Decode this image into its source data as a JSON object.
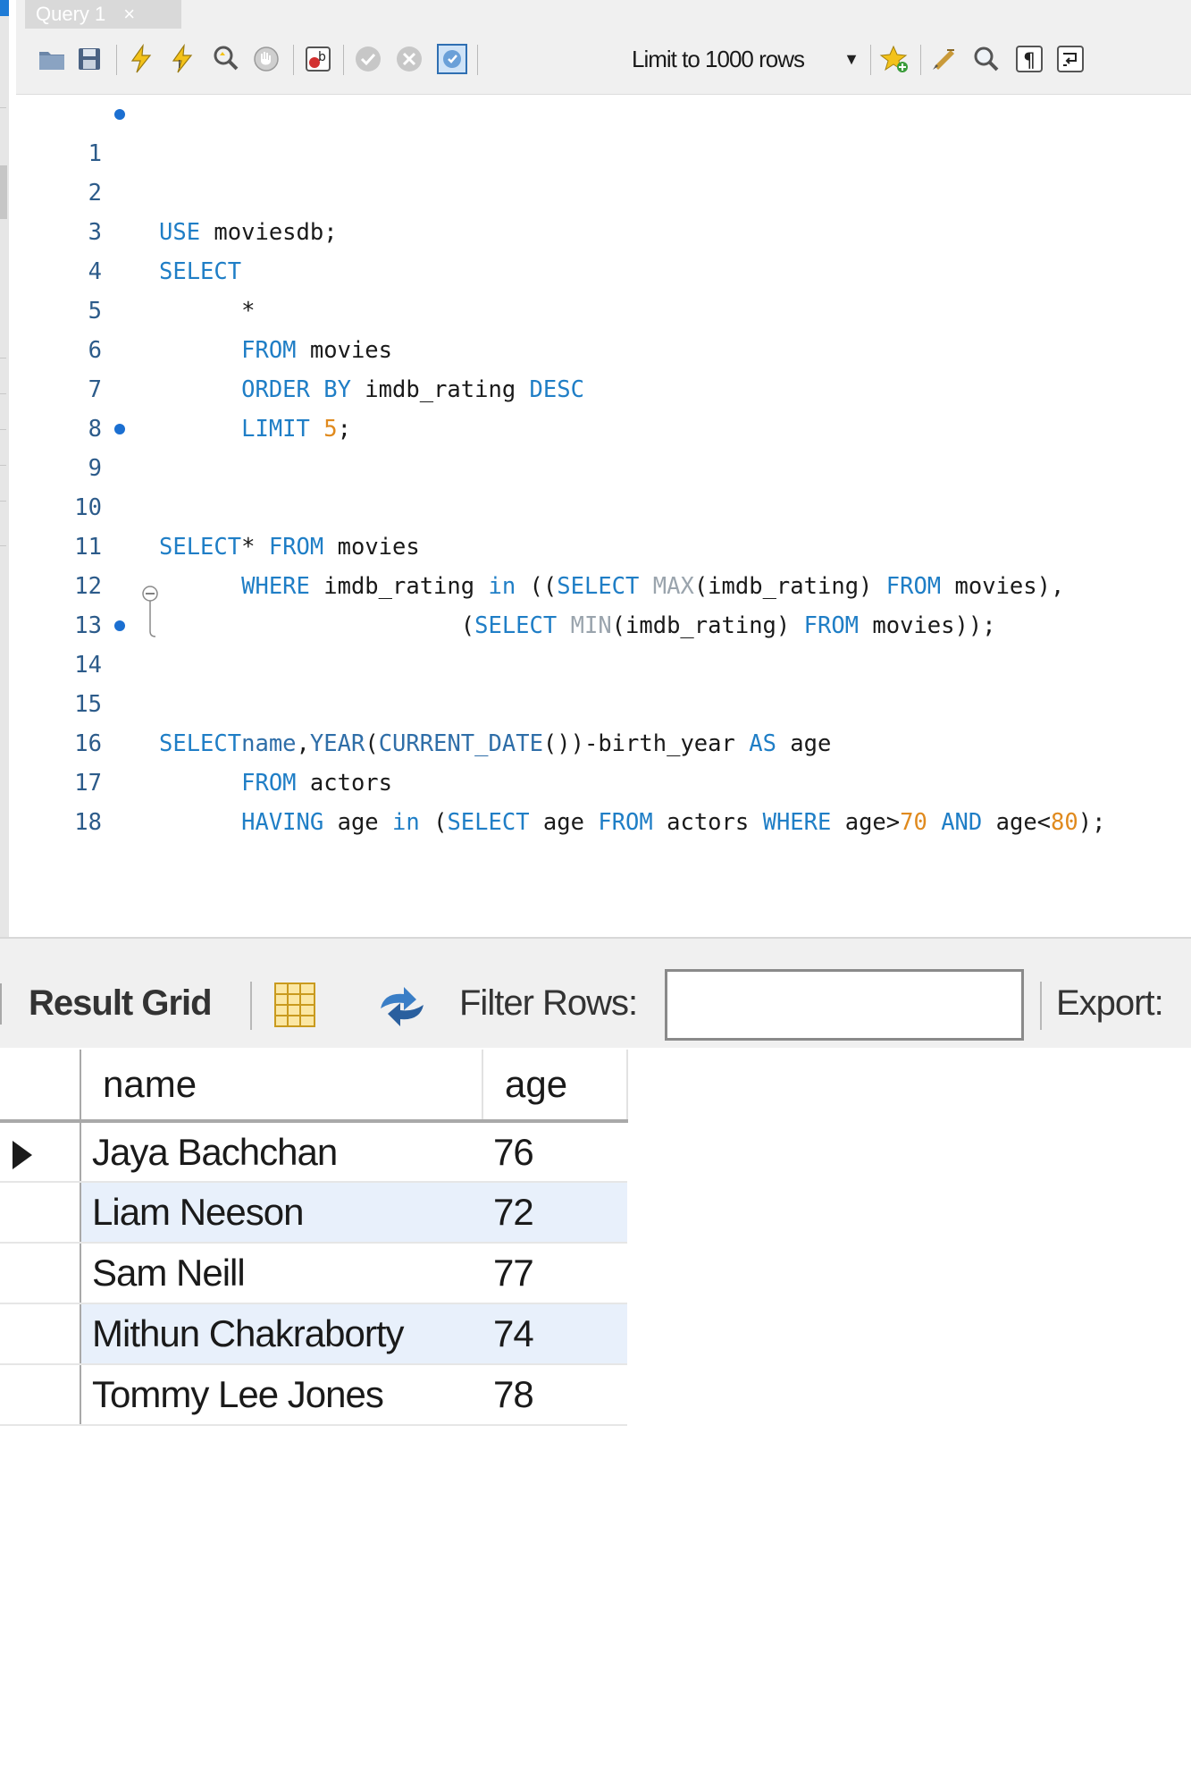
{
  "tab": {
    "label": "Query 1",
    "close": "×"
  },
  "toolbar": {
    "limit_label": "Limit to 1000 rows",
    "icons": [
      "open-file-icon",
      "save-icon",
      "execute-icon",
      "execute-current-icon",
      "explain-icon",
      "stop-icon",
      "error-toggle-icon",
      "commit-icon",
      "rollback-icon",
      "autocommit-icon",
      "limit-dropdown",
      "add-snippet-icon",
      "beautify-icon",
      "find-icon",
      "invisible-chars-icon",
      "wrap-lines-icon"
    ]
  },
  "editor": {
    "lines": [
      {
        "n": "1",
        "dot": true
      },
      {
        "n": "2",
        "dot": false
      },
      {
        "n": "3",
        "dot": false
      },
      {
        "n": "4",
        "dot": false
      },
      {
        "n": "5",
        "dot": false
      },
      {
        "n": "6",
        "dot": false
      },
      {
        "n": "7",
        "dot": false
      },
      {
        "n": "8",
        "dot": false
      },
      {
        "n": "9",
        "dot": true
      },
      {
        "n": "10",
        "dot": false
      },
      {
        "n": "11",
        "dot": false
      },
      {
        "n": "12",
        "dot": false
      },
      {
        "n": "13",
        "dot": false
      },
      {
        "n": "14",
        "dot": true
      },
      {
        "n": "15",
        "dot": false
      },
      {
        "n": "16",
        "dot": false
      },
      {
        "n": "17",
        "dot": false
      },
      {
        "n": "18",
        "dot": false
      }
    ],
    "code": {
      "l1": {
        "kw": "USE",
        "rest": " moviesdb;"
      },
      "l3": {
        "kw": "SELECT"
      },
      "l4": {
        "rest": "      *"
      },
      "l5": {
        "kw": "FROM",
        "rest": " movies"
      },
      "l6": {
        "kw1": "ORDER BY",
        "mid": " imdb_rating ",
        "kw2": "DESC"
      },
      "l7": {
        "kw": "LIMIT",
        "num": "5",
        "end": ";"
      },
      "l9": {
        "kw": "SELECT"
      },
      "l10": {
        "star": "* ",
        "kw": "FROM",
        "rest": " movies"
      },
      "l11": {
        "kw1": "WHERE",
        "a": " imdb_rating ",
        "kw2": "in",
        "b": " ((",
        "kw3": "SELECT",
        "sp": " ",
        "fn": "MAX",
        "c": "(imdb_rating) ",
        "kw4": "FROM",
        "d": " movies),"
      },
      "l12": {
        "a": "(",
        "kw1": "SELECT",
        "sp": " ",
        "fn": "MIN",
        "b": "(imdb_rating) ",
        "kw2": "FROM",
        "c": " movies));"
      },
      "l14": {
        "kw": "SELECT"
      },
      "l15": {
        "f1": "name",
        "a": ",",
        "f2": "YEAR",
        "b": "(",
        "f3": "CURRENT_DATE",
        "c": "())-birth_year ",
        "kw": "AS",
        "d": " age"
      },
      "l16": {
        "kw": "FROM",
        "rest": " actors"
      },
      "l17": {
        "kw1": "HAVING",
        "a": " age ",
        "kw2": "in",
        "b": " (",
        "kw3": "SELECT",
        "c": " age ",
        "kw4": "FROM",
        "d": " actors ",
        "kw5": "WHERE",
        "e": " age>",
        "n1": "70",
        "kw6": " AND",
        "f": " age<",
        "n2": "80",
        "g": ");"
      }
    }
  },
  "result": {
    "grid_label": "Result Grid",
    "filter_label": "Filter Rows:",
    "filter_value": "",
    "export_label": "Export:",
    "columns": [
      "name",
      "age"
    ],
    "rows": [
      {
        "name": "Jaya Bachchan",
        "age": "76"
      },
      {
        "name": "Liam Neeson",
        "age": "72"
      },
      {
        "name": "Sam Neill",
        "age": "77"
      },
      {
        "name": "Mithun Chakraborty",
        "age": "74"
      },
      {
        "name": "Tommy Lee Jones",
        "age": "78"
      }
    ]
  },
  "colors": {
    "keyword": "#1f7ec6",
    "number": "#e08a1e",
    "line_number": "#2c5b8a",
    "alt_row": "#e8f0fb"
  }
}
